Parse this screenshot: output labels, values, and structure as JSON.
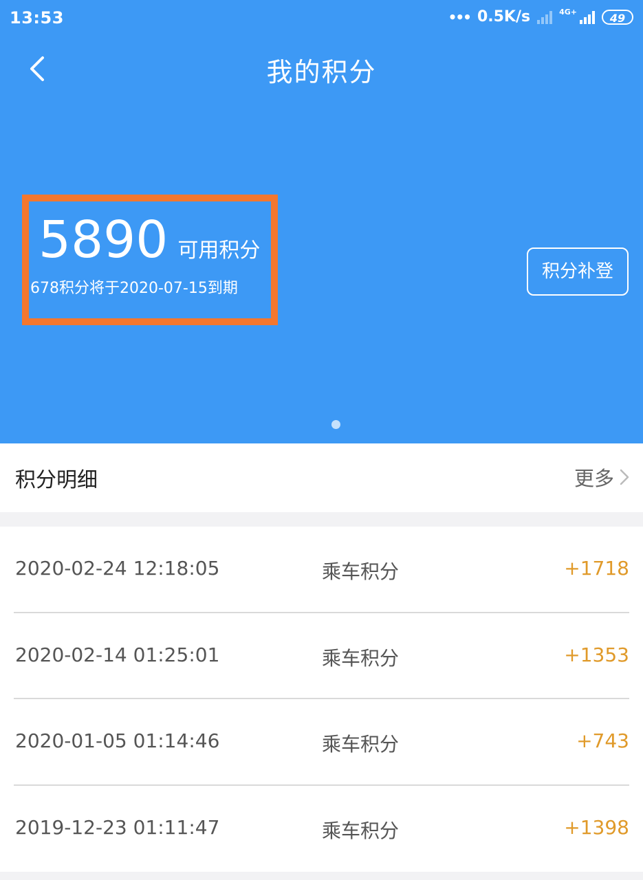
{
  "status_bar": {
    "time": "13:53",
    "network_speed": "0.5K/s",
    "network_type": "4G+",
    "battery": "49"
  },
  "header": {
    "title": "我的积分",
    "back_icon": "chevron-left-icon"
  },
  "points": {
    "value": "5890",
    "label": "可用积分",
    "expiry_note": "678积分将于2020-07-15到期",
    "makeup_button": "积分补登",
    "highlight_color": "#f4772e"
  },
  "details": {
    "title": "积分明细",
    "more_label": "更多",
    "records": [
      {
        "time": "2020-02-24 12:18:05",
        "type": "乘车积分",
        "points": "+1718"
      },
      {
        "time": "2020-02-14 01:25:01",
        "type": "乘车积分",
        "points": "+1353"
      },
      {
        "time": "2020-01-05 01:14:46",
        "type": "乘车积分",
        "points": "+743"
      },
      {
        "time": "2019-12-23 01:11:47",
        "type": "乘车积分",
        "points": "+1398"
      }
    ]
  },
  "colors": {
    "primary": "#3d99f5",
    "points_accent": "#e09a2a"
  }
}
